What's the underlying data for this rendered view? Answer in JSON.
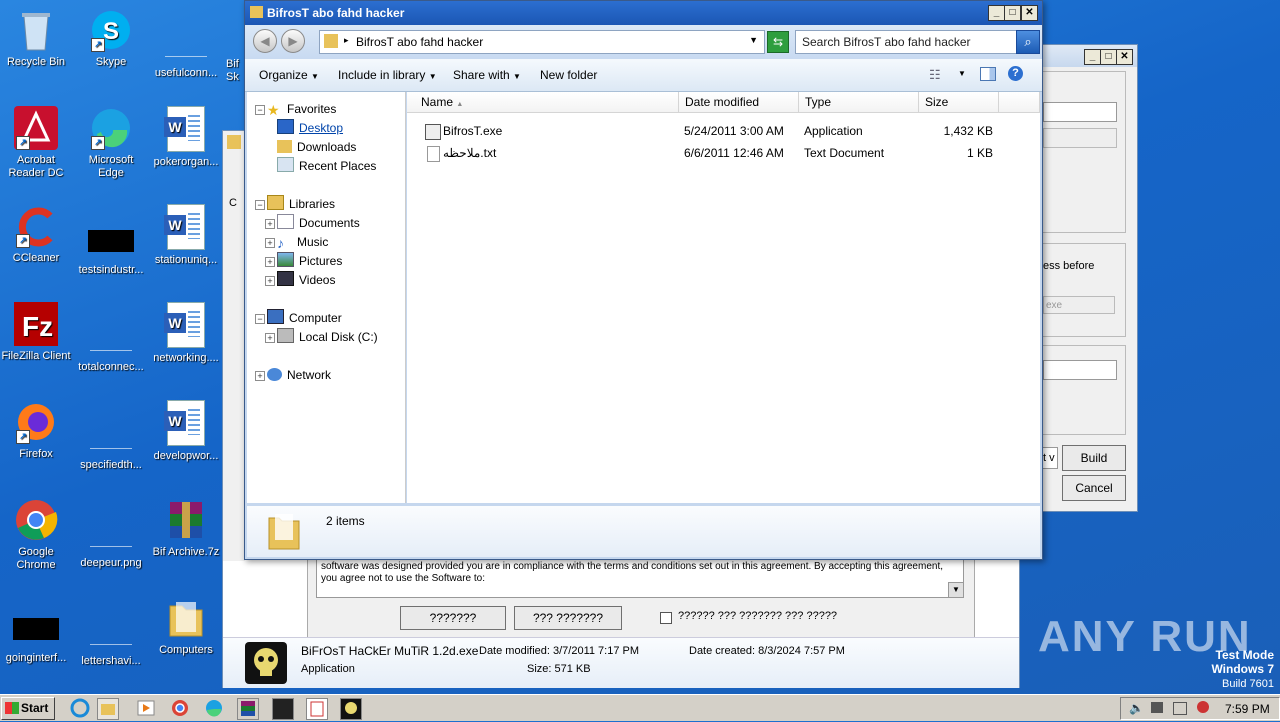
{
  "desktop_icons": [
    {
      "label": "Recycle Bin",
      "name": "recycle-bin-icon"
    },
    {
      "label": "Skype",
      "name": "skype-icon"
    },
    {
      "label": "usefulconn...",
      "name": "usefulconn-icon"
    },
    {
      "label": "Acrobat Reader DC",
      "name": "acrobat-icon"
    },
    {
      "label": "Microsoft Edge",
      "name": "edge-icon"
    },
    {
      "label": "pokerorgan...",
      "name": "pokerorgan-icon"
    },
    {
      "label": "CCleaner",
      "name": "ccleaner-icon"
    },
    {
      "label": "testsindustr...",
      "name": "testsindustr-icon"
    },
    {
      "label": "stationuniq...",
      "name": "stationuniq-icon"
    },
    {
      "label": "FileZilla Client",
      "name": "filezilla-icon"
    },
    {
      "label": "totalconnec...",
      "name": "totalconnec-icon"
    },
    {
      "label": "networking....",
      "name": "networking-icon"
    },
    {
      "label": "Firefox",
      "name": "firefox-icon"
    },
    {
      "label": "specifiedth...",
      "name": "specifiedth-icon"
    },
    {
      "label": "developwor...",
      "name": "developwor-icon"
    },
    {
      "label": "Google Chrome",
      "name": "chrome-icon"
    },
    {
      "label": "deepeur.png",
      "name": "deepeur-icon"
    },
    {
      "label": "Bif Archive.7z",
      "name": "bif-archive-icon"
    },
    {
      "label": "goinginterf...",
      "name": "goinginterf-icon"
    },
    {
      "label": "lettershavi...",
      "name": "lettershavi-icon"
    },
    {
      "label": "Computers",
      "name": "computers-folder-icon"
    }
  ],
  "partial_icon_label": "Bif Sk",
  "explorer": {
    "title": "BifrosT abo fahd hacker",
    "address": "BifrosT abo fahd hacker",
    "search_placeholder": "Search BifrosT abo fahd hacker",
    "toolbar": {
      "organize": "Organize",
      "include": "Include in library",
      "share": "Share with",
      "new_folder": "New folder"
    },
    "nav": {
      "favorites": "Favorites",
      "desktop": "Desktop",
      "downloads": "Downloads",
      "recent": "Recent Places",
      "libraries": "Libraries",
      "documents": "Documents",
      "music": "Music",
      "pictures": "Pictures",
      "videos": "Videos",
      "computer": "Computer",
      "local_disk": "Local Disk (C:)",
      "network": "Network"
    },
    "columns": {
      "name": "Name",
      "date": "Date modified",
      "type": "Type",
      "size": "Size"
    },
    "files": [
      {
        "name": "BifrosT.exe",
        "date": "5/24/2011 3:00 AM",
        "type": "Application",
        "size": "1,432 KB"
      },
      {
        "name": "ملاحظه.txt",
        "date": "6/6/2011 12:46 AM",
        "type": "Text Document",
        "size": "1 KB"
      }
    ],
    "item_count": "2 items"
  },
  "builder_window": {
    "text_fragment": "ess before",
    "exe_placeholder": "exe",
    "partial_label": "t v",
    "build": "Build",
    "cancel": "Cancel"
  },
  "license_dialog": {
    "c_label": "C",
    "text": "software was designed provided you are in compliance with the terms and conditions set out in this agreement. By accepting this agreement, you agree not to use the Software to:",
    "btn1": "???????",
    "btn2": "??? ???????",
    "checkbox_label": "?????? ??? ??????? ??? ?????"
  },
  "status_bar": {
    "filename": "BiFrOsT HaCkEr MuTiR 1.2d.exe",
    "date_modified": "Date modified: 3/7/2011 7:17 PM",
    "date_created": "Date created: 8/3/2024 7:57 PM",
    "type": "Application",
    "size": "Size: 571 KB"
  },
  "watermark": {
    "brand": "ANY RUN",
    "mode": "Test Mode",
    "os": "Windows 7",
    "build": "Build 7601"
  },
  "taskbar": {
    "start": "Start",
    "clock": "7:59 PM"
  }
}
